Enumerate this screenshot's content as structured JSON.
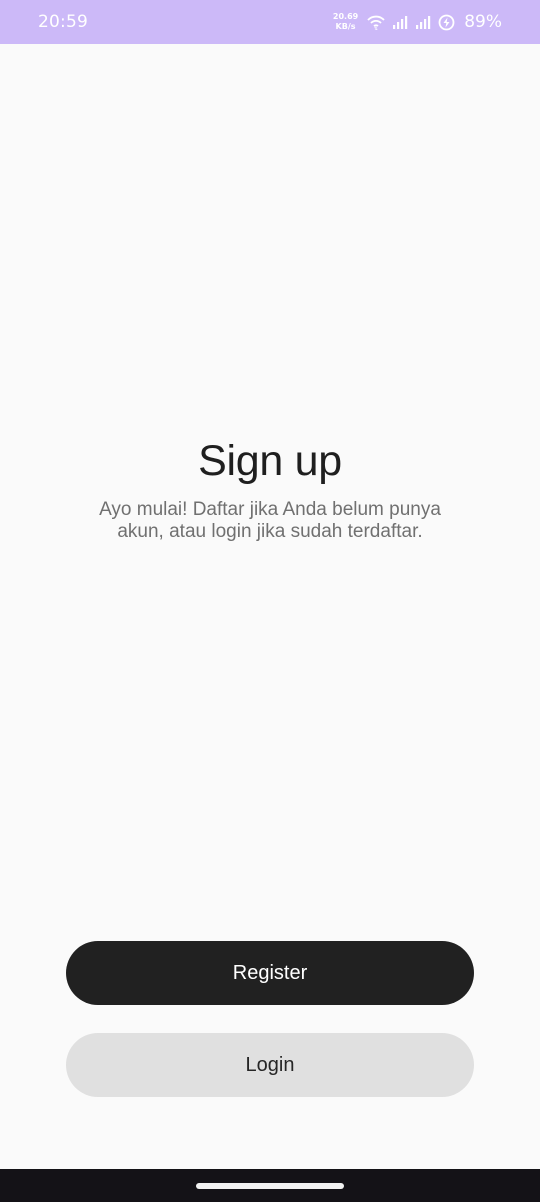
{
  "status_bar": {
    "time": "20:59",
    "net_speed_value": "20.69",
    "net_speed_unit": "KB/s",
    "battery_percent": "89%",
    "background_color": "#ccb9f8",
    "icons": [
      "wifi-icon",
      "signal-icon",
      "signal-icon",
      "battery-charging-icon"
    ]
  },
  "main": {
    "title": "Sign up",
    "subtitle": "Ayo mulai! Daftar jika Anda belum punya akun, atau login jika sudah terdaftar."
  },
  "actions": {
    "register_label": "Register",
    "login_label": "Login",
    "register_color": "#212121",
    "login_color": "#e0e0e0"
  }
}
